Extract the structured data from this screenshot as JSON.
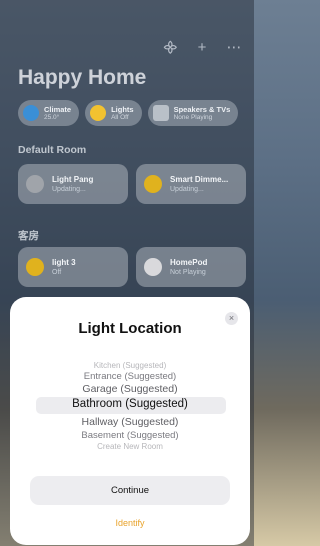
{
  "toolbar": {
    "icons": [
      "waveform-icon",
      "plus-icon",
      "more-icon"
    ],
    "glyphs": [
      "᯽",
      "+",
      "⋯"
    ]
  },
  "home": {
    "title": "Happy Home"
  },
  "chips": [
    {
      "name": "Climate",
      "status": "25.0°",
      "color": "#3a8fd6"
    },
    {
      "name": "Lights",
      "status": "All Off",
      "color": "#f2c230"
    },
    {
      "name": "Speakers & TVs",
      "status": "None Playing",
      "color": "#b9c0c8"
    }
  ],
  "sections": {
    "default_room": "Default Room",
    "room2": "客房"
  },
  "tiles": [
    {
      "name": "Light Pang",
      "status": "Updating...",
      "color": "#a0a4aa"
    },
    {
      "name": "Smart Dimme...",
      "status": "Updating...",
      "color": "#e0b21e"
    },
    {
      "name": "light 3",
      "status": "Off",
      "color": "#e0b21e"
    },
    {
      "name": "HomePod",
      "status": "Not Playing",
      "color": "#d9d9dc"
    }
  ],
  "sheet": {
    "title": "Light Location",
    "close_glyph": "×",
    "options": [
      "Kitchen (Suggested)",
      "Entrance (Suggested)",
      "Garage (Suggested)",
      "Bathroom (Suggested)",
      "Hallway (Suggested)",
      "Basement (Suggested)",
      "Create New Room"
    ],
    "selected": "Bathroom (Suggested)",
    "continue_label": "Continue",
    "identify_label": "Identify",
    "accent": "#e8a32b"
  }
}
